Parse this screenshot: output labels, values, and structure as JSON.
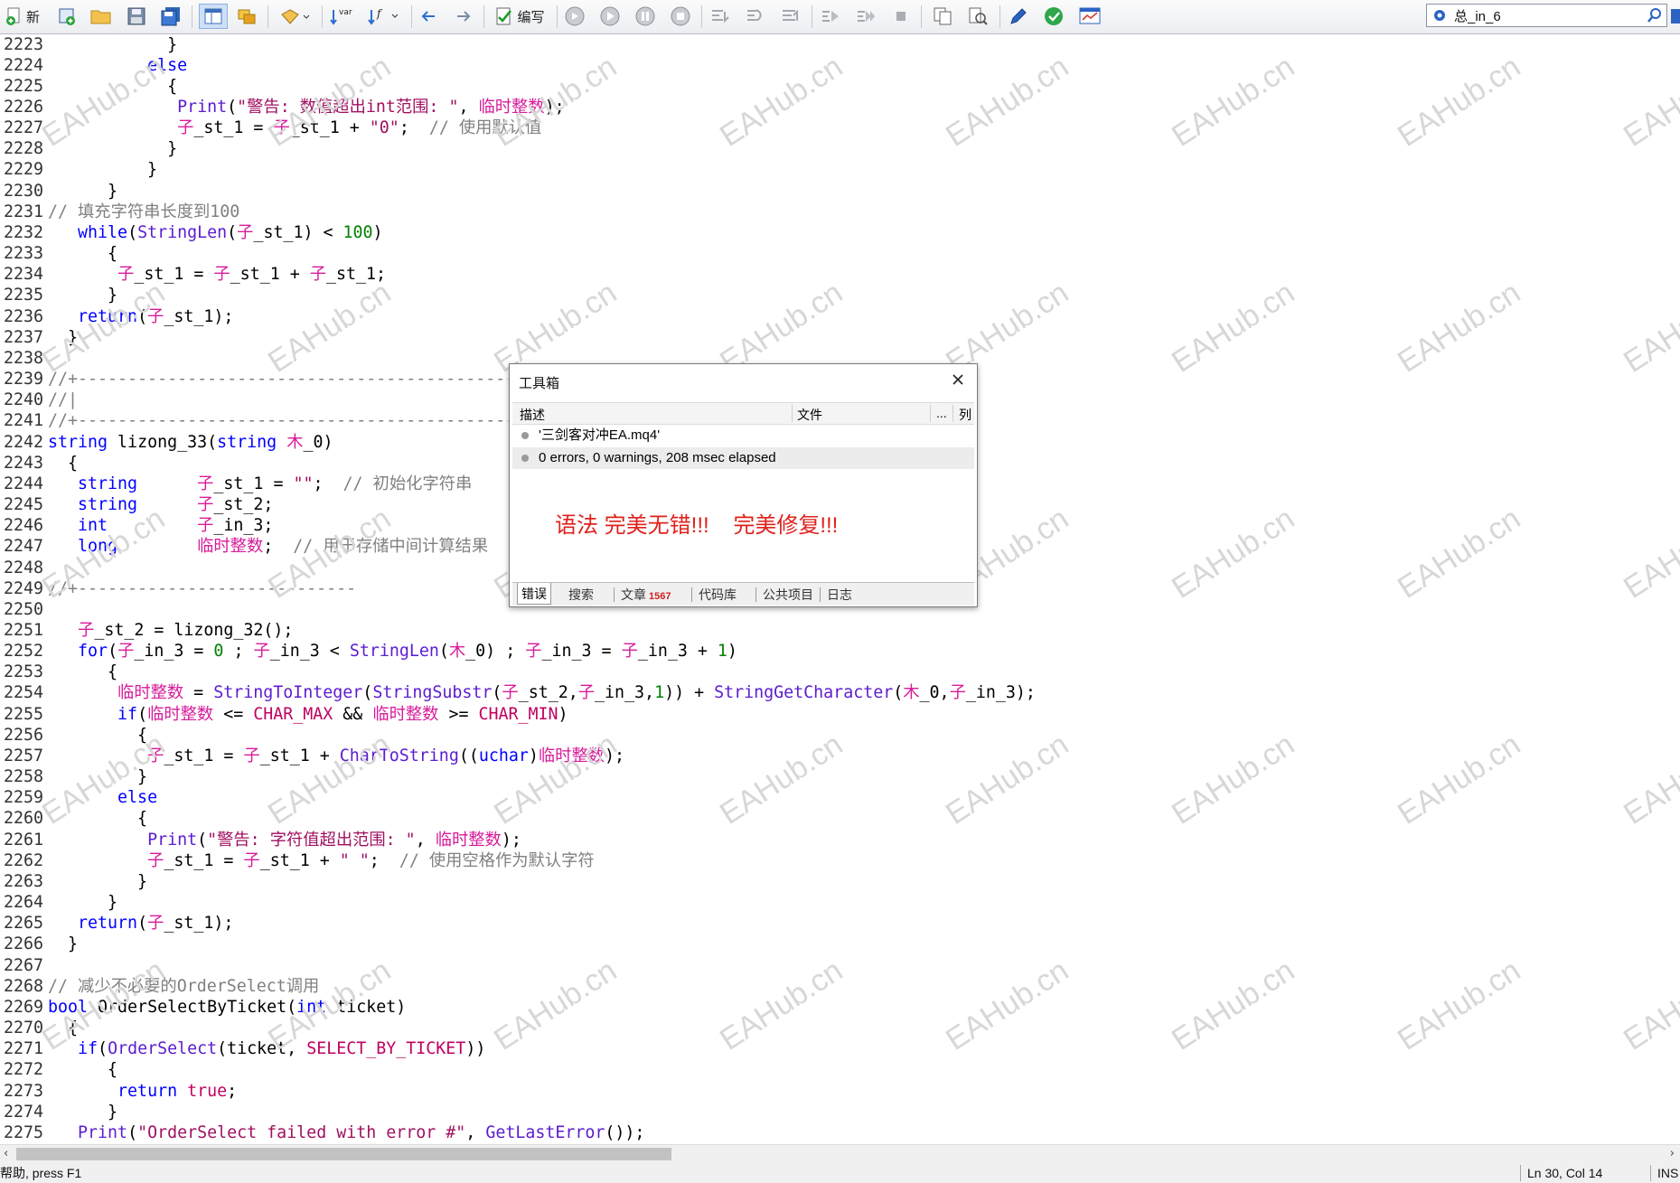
{
  "toolbar": {
    "new_label": "新",
    "compile_label": "编写",
    "var_label": "var",
    "search_value": "总_in_6"
  },
  "code": [
    {
      "n": "2223",
      "t": [
        [
          "            }",
          ""
        ]
      ]
    },
    {
      "n": "2224",
      "t": [
        [
          "          ",
          ""
        ],
        [
          "else",
          "kw"
        ]
      ]
    },
    {
      "n": "2225",
      "t": [
        [
          "            {",
          ""
        ]
      ]
    },
    {
      "n": "2226",
      "t": [
        [
          "             ",
          ""
        ],
        [
          "Print",
          "fn"
        ],
        [
          "(",
          ""
        ],
        [
          "\"警告: 数值超出int范围: \"",
          "str"
        ],
        [
          ", ",
          ""
        ],
        [
          "临时整数",
          "id"
        ],
        [
          ");",
          ""
        ]
      ]
    },
    {
      "n": "2227",
      "t": [
        [
          "             ",
          ""
        ],
        [
          "子",
          "id"
        ],
        [
          "_st_1 = ",
          ""
        ],
        [
          "子",
          "id"
        ],
        [
          "_st_1 + ",
          ""
        ],
        [
          "\"0\"",
          "str"
        ],
        [
          ";  ",
          ""
        ],
        [
          "// 使用默认值",
          "cm"
        ]
      ]
    },
    {
      "n": "2228",
      "t": [
        [
          "            }",
          ""
        ]
      ]
    },
    {
      "n": "2229",
      "t": [
        [
          "          }",
          ""
        ]
      ]
    },
    {
      "n": "2230",
      "t": [
        [
          "      }",
          ""
        ]
      ]
    },
    {
      "n": "2231",
      "t": [
        [
          "// 填充字符串长度到100",
          "cm"
        ]
      ]
    },
    {
      "n": "2232",
      "t": [
        [
          "   ",
          ""
        ],
        [
          "while",
          "kw"
        ],
        [
          "(",
          ""
        ],
        [
          "StringLen",
          "fn"
        ],
        [
          "(",
          ""
        ],
        [
          "子",
          "id"
        ],
        [
          "_st_1) < ",
          ""
        ],
        [
          "100",
          "num"
        ],
        [
          ")",
          ""
        ]
      ]
    },
    {
      "n": "2233",
      "t": [
        [
          "      {",
          ""
        ]
      ]
    },
    {
      "n": "2234",
      "t": [
        [
          "       ",
          ""
        ],
        [
          "子",
          "id"
        ],
        [
          "_st_1 = ",
          ""
        ],
        [
          "子",
          "id"
        ],
        [
          "_st_1 + ",
          ""
        ],
        [
          "子",
          "id"
        ],
        [
          "_st_1;",
          ""
        ]
      ]
    },
    {
      "n": "2235",
      "t": [
        [
          "      }",
          ""
        ]
      ]
    },
    {
      "n": "2236",
      "t": [
        [
          "   ",
          ""
        ],
        [
          "return",
          "kw"
        ],
        [
          "(",
          ""
        ],
        [
          "子",
          "id"
        ],
        [
          "_st_1);",
          ""
        ]
      ]
    },
    {
      "n": "2237",
      "t": [
        [
          "  }",
          ""
        ]
      ]
    },
    {
      "n": "2238",
      "t": [
        [
          "",
          ""
        ]
      ]
    },
    {
      "n": "2239",
      "t": [
        [
          "//+------------------------------------------------------------------",
          "cm"
        ]
      ]
    },
    {
      "n": "2240",
      "t": [
        [
          "//|",
          "cm"
        ]
      ]
    },
    {
      "n": "2241",
      "t": [
        [
          "//+------------------------------------------------------------------",
          "cm"
        ]
      ]
    },
    {
      "n": "2242",
      "t": [
        [
          "string",
          "kw"
        ],
        [
          " lizong_33(",
          ""
        ],
        [
          "string",
          "kw"
        ],
        [
          " ",
          ""
        ],
        [
          "木",
          "id"
        ],
        [
          "_0)",
          ""
        ]
      ]
    },
    {
      "n": "2243",
      "t": [
        [
          "  {",
          ""
        ]
      ]
    },
    {
      "n": "2244",
      "t": [
        [
          "   ",
          ""
        ],
        [
          "string",
          "kw"
        ],
        [
          "      ",
          ""
        ],
        [
          "子",
          "id"
        ],
        [
          "_st_1 = ",
          ""
        ],
        [
          "\"\"",
          "str"
        ],
        [
          ";  ",
          ""
        ],
        [
          "// 初始化字符串",
          "cm"
        ]
      ]
    },
    {
      "n": "2245",
      "t": [
        [
          "   ",
          ""
        ],
        [
          "string",
          "kw"
        ],
        [
          "      ",
          ""
        ],
        [
          "子",
          "id"
        ],
        [
          "_st_2;",
          ""
        ]
      ]
    },
    {
      "n": "2246",
      "t": [
        [
          "   ",
          ""
        ],
        [
          "int",
          "kw"
        ],
        [
          "         ",
          ""
        ],
        [
          "子",
          "id"
        ],
        [
          "_in_3;",
          ""
        ]
      ]
    },
    {
      "n": "2247",
      "t": [
        [
          "   ",
          ""
        ],
        [
          "long",
          "kw"
        ],
        [
          "        ",
          ""
        ],
        [
          "临时整数",
          "id"
        ],
        [
          ";  ",
          ""
        ],
        [
          "// 用于存储中间计算结果",
          "cm"
        ]
      ]
    },
    {
      "n": "2248",
      "t": [
        [
          "",
          ""
        ]
      ]
    },
    {
      "n": "2249",
      "t": [
        [
          "//+----------------------------",
          "cm"
        ]
      ]
    },
    {
      "n": "2250",
      "t": [
        [
          "",
          ""
        ]
      ]
    },
    {
      "n": "2251",
      "t": [
        [
          "   ",
          ""
        ],
        [
          "子",
          "id"
        ],
        [
          "_st_2 = lizong_32();",
          ""
        ]
      ]
    },
    {
      "n": "2252",
      "t": [
        [
          "   ",
          ""
        ],
        [
          "for",
          "kw"
        ],
        [
          "(",
          ""
        ],
        [
          "子",
          "id"
        ],
        [
          "_in_3 = ",
          ""
        ],
        [
          "0",
          "num"
        ],
        [
          " ; ",
          ""
        ],
        [
          "子",
          "id"
        ],
        [
          "_in_3 < ",
          ""
        ],
        [
          "StringLen",
          "fn"
        ],
        [
          "(",
          ""
        ],
        [
          "木",
          "id"
        ],
        [
          "_0) ; ",
          ""
        ],
        [
          "子",
          "id"
        ],
        [
          "_in_3 = ",
          ""
        ],
        [
          "子",
          "id"
        ],
        [
          "_in_3 + ",
          ""
        ],
        [
          "1",
          "num"
        ],
        [
          ")",
          ""
        ]
      ]
    },
    {
      "n": "2253",
      "t": [
        [
          "      {",
          ""
        ]
      ]
    },
    {
      "n": "2254",
      "t": [
        [
          "       ",
          ""
        ],
        [
          "临时整数",
          "id"
        ],
        [
          " = ",
          ""
        ],
        [
          "StringToInteger",
          "fn"
        ],
        [
          "(",
          ""
        ],
        [
          "StringSubstr",
          "fn"
        ],
        [
          "(",
          ""
        ],
        [
          "子",
          "id"
        ],
        [
          "_st_2,",
          ""
        ],
        [
          "子",
          "id"
        ],
        [
          "_in_3,",
          ""
        ],
        [
          "1",
          "num"
        ],
        [
          ")) + ",
          ""
        ],
        [
          "StringGetCharacter",
          "fn"
        ],
        [
          "(",
          ""
        ],
        [
          "木",
          "id"
        ],
        [
          "_0,",
          ""
        ],
        [
          "子",
          "id"
        ],
        [
          "_in_3);",
          ""
        ]
      ]
    },
    {
      "n": "2255",
      "t": [
        [
          "       ",
          ""
        ],
        [
          "if",
          "kw"
        ],
        [
          "(",
          ""
        ],
        [
          "临时整数",
          "id"
        ],
        [
          " <= ",
          ""
        ],
        [
          "CHAR_MAX",
          "cn"
        ],
        [
          " && ",
          ""
        ],
        [
          "临时整数",
          "id"
        ],
        [
          " >= ",
          ""
        ],
        [
          "CHAR_MIN",
          "cn"
        ],
        [
          ")",
          ""
        ]
      ]
    },
    {
      "n": "2256",
      "t": [
        [
          "         {",
          ""
        ]
      ]
    },
    {
      "n": "2257",
      "t": [
        [
          "          ",
          ""
        ],
        [
          "子",
          "id"
        ],
        [
          "_st_1 = ",
          ""
        ],
        [
          "子",
          "id"
        ],
        [
          "_st_1 + ",
          ""
        ],
        [
          "CharToString",
          "fn"
        ],
        [
          "((",
          ""
        ],
        [
          "uchar",
          "kw"
        ],
        [
          ")",
          ""
        ],
        [
          "临时整数",
          "id"
        ],
        [
          ");",
          ""
        ]
      ]
    },
    {
      "n": "2258",
      "t": [
        [
          "         }",
          ""
        ]
      ]
    },
    {
      "n": "2259",
      "t": [
        [
          "       ",
          ""
        ],
        [
          "else",
          "kw"
        ]
      ]
    },
    {
      "n": "2260",
      "t": [
        [
          "         {",
          ""
        ]
      ]
    },
    {
      "n": "2261",
      "t": [
        [
          "          ",
          ""
        ],
        [
          "Print",
          "fn"
        ],
        [
          "(",
          ""
        ],
        [
          "\"警告: 字符值超出范围: \"",
          "str"
        ],
        [
          ", ",
          ""
        ],
        [
          "临时整数",
          "id"
        ],
        [
          ");",
          ""
        ]
      ]
    },
    {
      "n": "2262",
      "t": [
        [
          "          ",
          ""
        ],
        [
          "子",
          "id"
        ],
        [
          "_st_1 = ",
          ""
        ],
        [
          "子",
          "id"
        ],
        [
          "_st_1 + ",
          ""
        ],
        [
          "\" \"",
          "str"
        ],
        [
          ";  ",
          ""
        ],
        [
          "// 使用空格作为默认字符",
          "cm"
        ]
      ]
    },
    {
      "n": "2263",
      "t": [
        [
          "         }",
          ""
        ]
      ]
    },
    {
      "n": "2264",
      "t": [
        [
          "      }",
          ""
        ]
      ]
    },
    {
      "n": "2265",
      "t": [
        [
          "   ",
          ""
        ],
        [
          "return",
          "kw"
        ],
        [
          "(",
          ""
        ],
        [
          "子",
          "id"
        ],
        [
          "_st_1);",
          ""
        ]
      ]
    },
    {
      "n": "2266",
      "t": [
        [
          "  }",
          ""
        ]
      ]
    },
    {
      "n": "2267",
      "t": [
        [
          "",
          ""
        ]
      ]
    },
    {
      "n": "2268",
      "t": [
        [
          "// 减少不必要的OrderSelect调用",
          "cm"
        ]
      ]
    },
    {
      "n": "2269",
      "t": [
        [
          "bool",
          "kw"
        ],
        [
          " OrderSelectByTicket(",
          ""
        ],
        [
          "int",
          "kw"
        ],
        [
          " ticket)",
          ""
        ]
      ]
    },
    {
      "n": "2270",
      "t": [
        [
          "  {",
          ""
        ]
      ]
    },
    {
      "n": "2271",
      "t": [
        [
          "   ",
          ""
        ],
        [
          "if",
          "kw"
        ],
        [
          "(",
          ""
        ],
        [
          "OrderSelect",
          "fn"
        ],
        [
          "(ticket, ",
          ""
        ],
        [
          "SELECT_BY_TICKET",
          "cn"
        ],
        [
          "))",
          ""
        ]
      ]
    },
    {
      "n": "2272",
      "t": [
        [
          "      {",
          ""
        ]
      ]
    },
    {
      "n": "2273",
      "t": [
        [
          "       ",
          ""
        ],
        [
          "return",
          "kw"
        ],
        [
          " ",
          ""
        ],
        [
          "true",
          "cn"
        ],
        [
          ";",
          ""
        ]
      ]
    },
    {
      "n": "2274",
      "t": [
        [
          "      }",
          ""
        ]
      ]
    },
    {
      "n": "2275",
      "t": [
        [
          "   ",
          ""
        ],
        [
          "Print",
          "fn"
        ],
        [
          "(",
          ""
        ],
        [
          "\"OrderSelect failed with error #\"",
          "str"
        ],
        [
          ", ",
          ""
        ],
        [
          "GetLastError",
          "fn"
        ],
        [
          "());",
          ""
        ]
      ]
    }
  ],
  "watermark": "EAHub.cn",
  "toolbox": {
    "title": "工具箱",
    "columns": {
      "desc": "描述",
      "file": "文件",
      "dots": "...",
      "col": "列"
    },
    "messages": [
      "'三剑客对冲EA.mq4'",
      "0 errors, 0 warnings, 208 msec elapsed"
    ],
    "note": "语法 完美无错!!!    完美修复!!!",
    "tabs": [
      {
        "label": "错误"
      },
      {
        "label": "搜索"
      },
      {
        "label": "文章",
        "badge": "1567"
      },
      {
        "label": "代码库"
      },
      {
        "label": "公共项目"
      },
      {
        "label": "日志"
      }
    ]
  },
  "status": {
    "help": "帮助, press F1",
    "position": "Ln 30, Col 14",
    "mode": "INS"
  },
  "colors": {
    "accent": "#0b59c7",
    "error_red": "#e0211c",
    "keyword": "#0000ff",
    "function": "#5b1bd1",
    "identifier": "#d81b9a"
  }
}
